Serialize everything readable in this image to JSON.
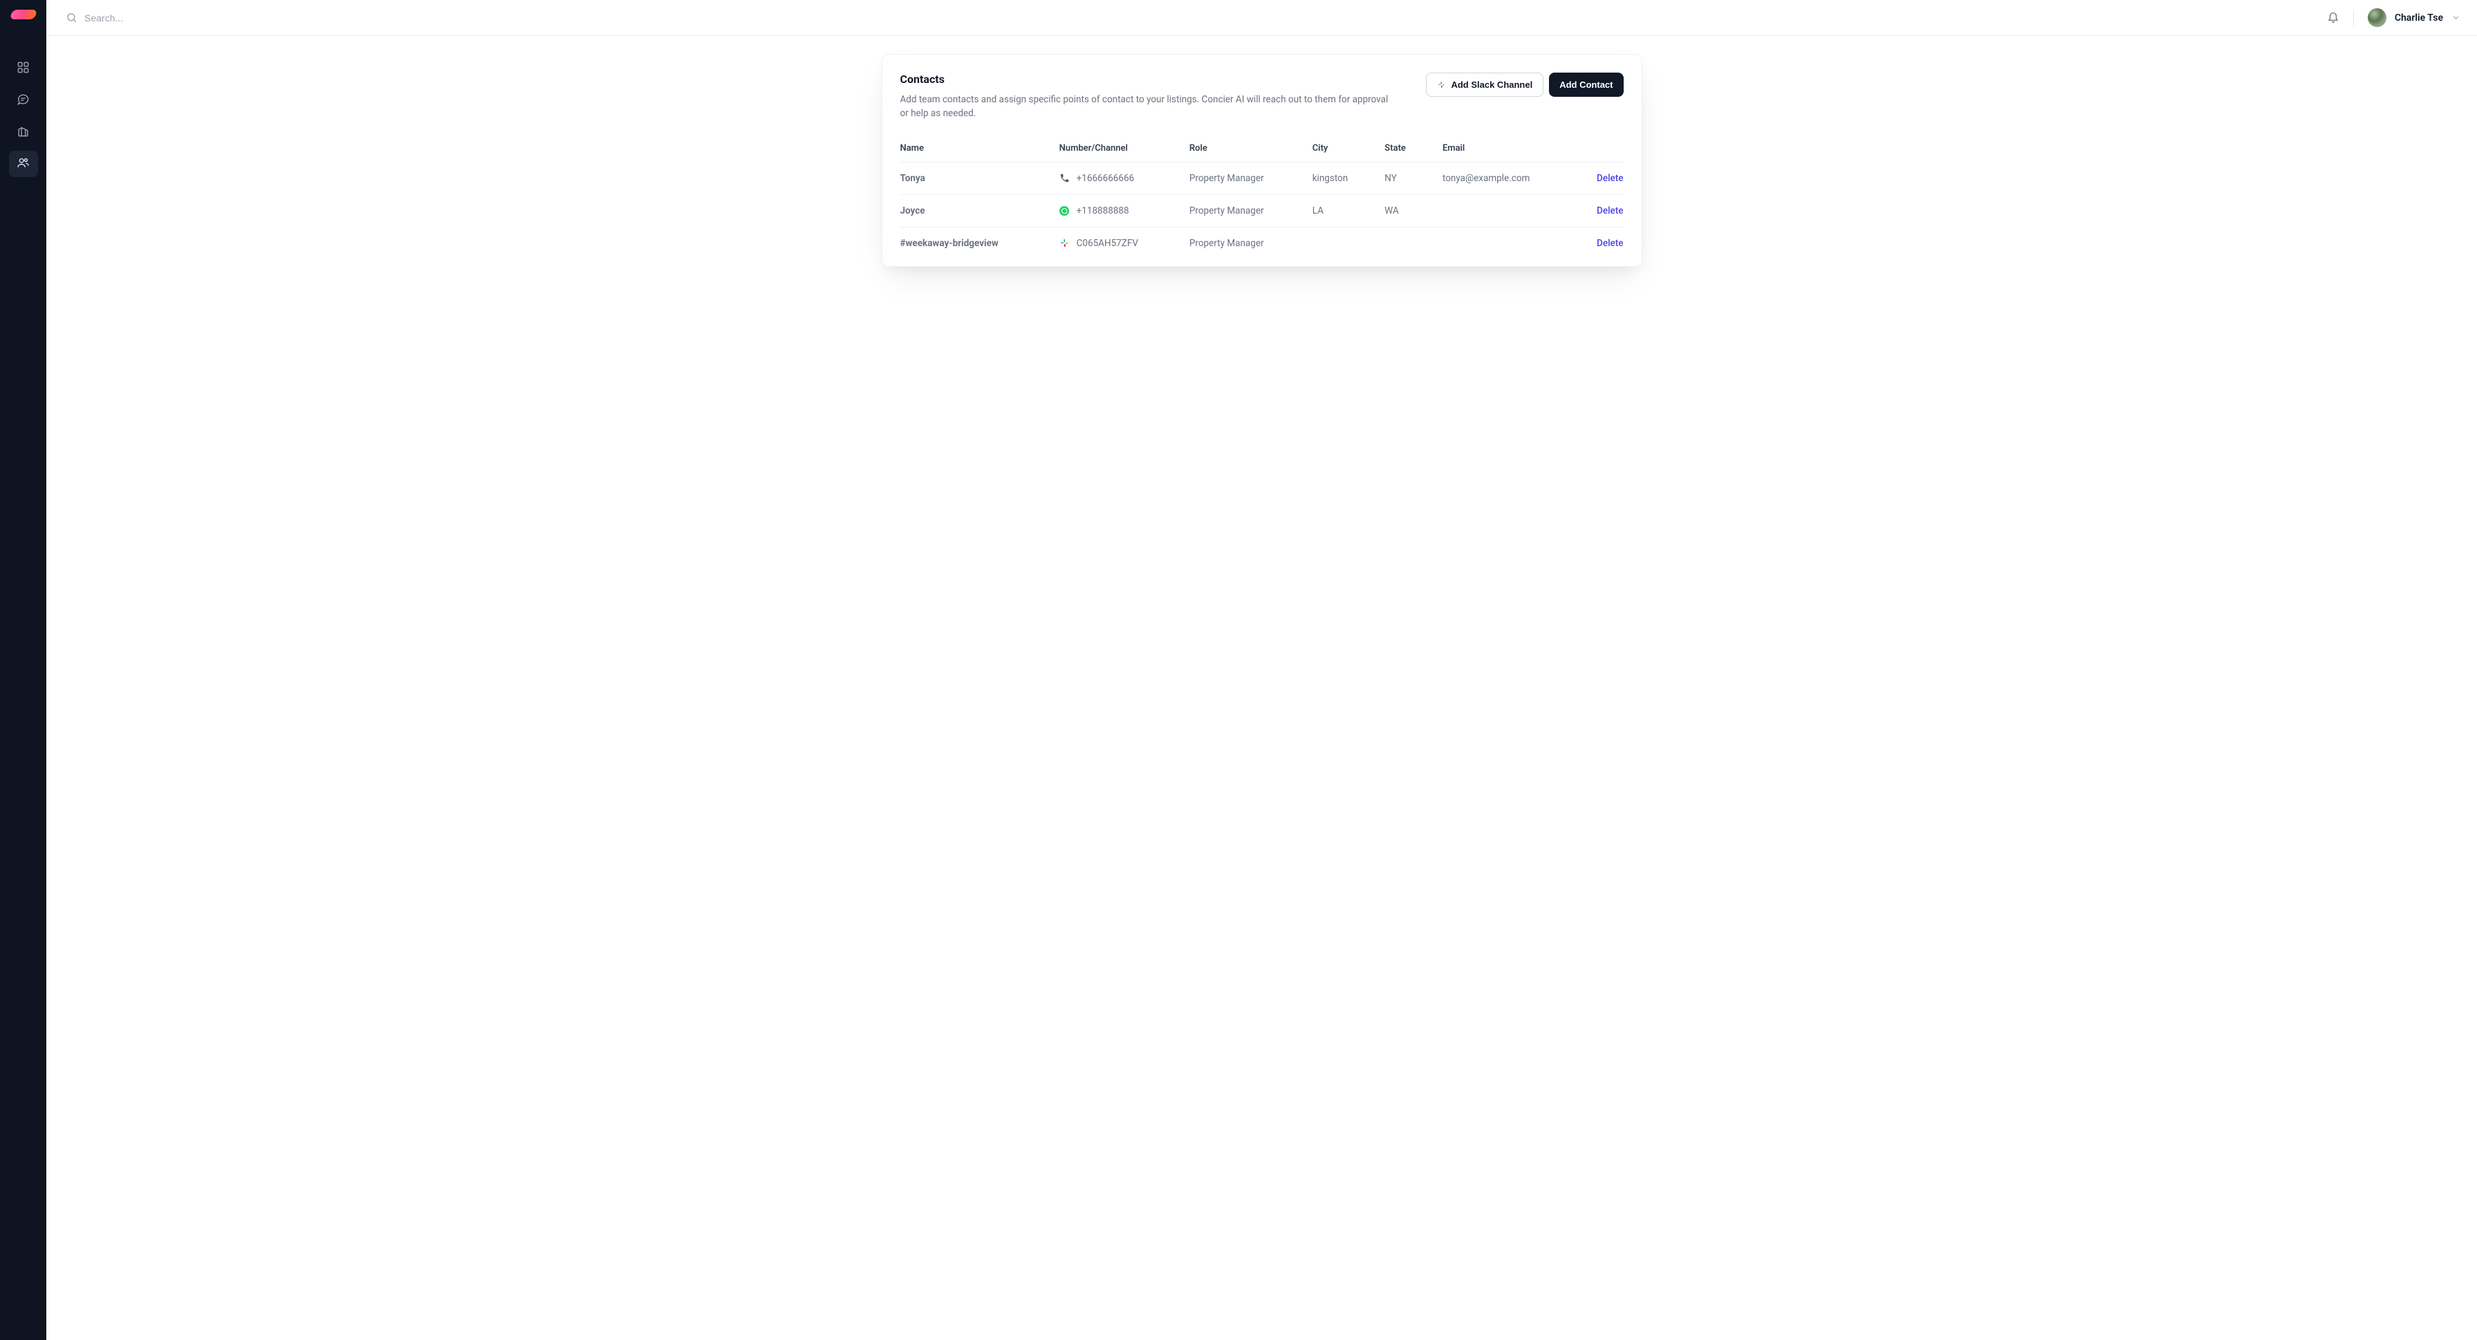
{
  "search": {
    "placeholder": "Search..."
  },
  "user": {
    "name": "Charlie Tse"
  },
  "page": {
    "title": "Contacts",
    "subtitle": "Add team contacts and assign specific points of contact to your listings. Concier AI will reach out to them for approval or help as needed."
  },
  "actions": {
    "add_slack": "Add Slack Channel",
    "add_contact": "Add Contact"
  },
  "table": {
    "headers": {
      "name": "Name",
      "number": "Number/Channel",
      "role": "Role",
      "city": "City",
      "state": "State",
      "email": "Email"
    },
    "rows": [
      {
        "name": "Tonya",
        "channel_type": "phone",
        "number": "+1666666666",
        "role": "Property Manager",
        "city": "kingston",
        "state": "NY",
        "email": "tonya@example.com",
        "action": "Delete"
      },
      {
        "name": "Joyce",
        "channel_type": "whatsapp",
        "number": "+118888888",
        "role": "Property Manager",
        "city": "LA",
        "state": "WA",
        "email": "",
        "action": "Delete"
      },
      {
        "name": "#weekaway-bridgeview",
        "channel_type": "slack",
        "number": "C065AH57ZFV",
        "role": "Property Manager",
        "city": "",
        "state": "",
        "email": "",
        "action": "Delete"
      }
    ]
  }
}
